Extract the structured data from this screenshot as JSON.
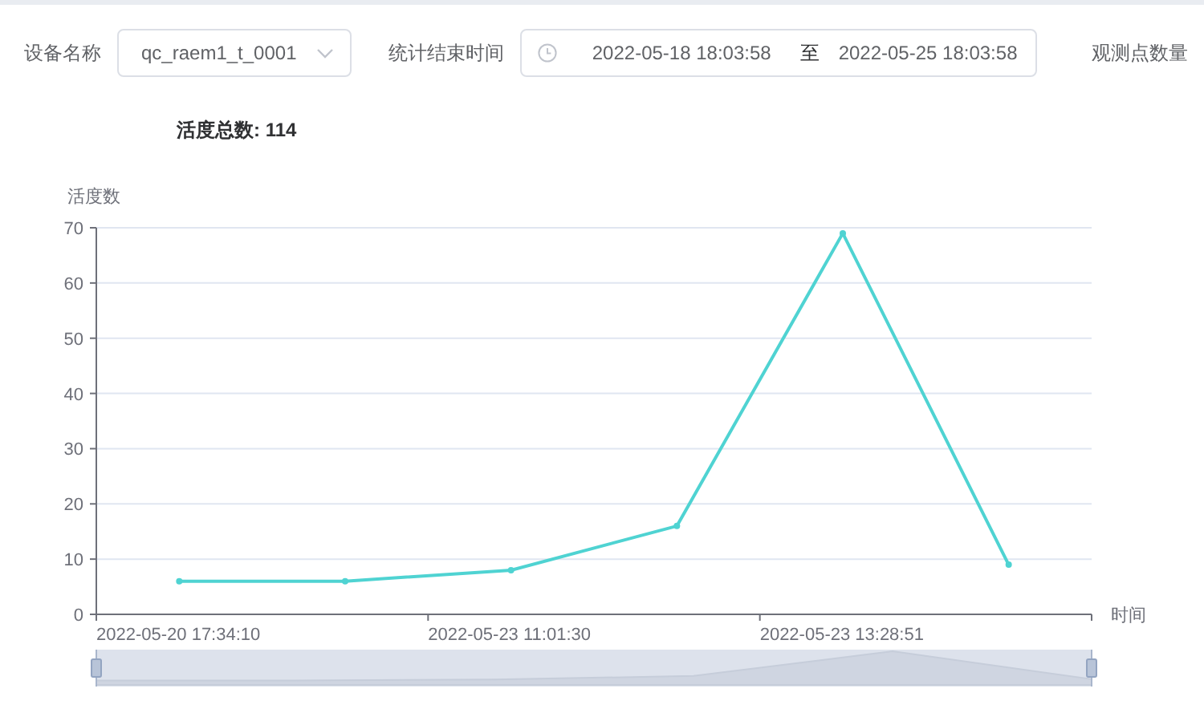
{
  "filters": [
    {
      "kind": "select",
      "label": "设备名称",
      "value": "qc_raem1_t_0001"
    },
    {
      "kind": "daterange",
      "label": "统计结束时间",
      "start": "2022-05-18 18:03:58",
      "separator": "至",
      "end": "2022-05-25 18:03:58"
    },
    {
      "kind": "label",
      "label": "观测点数量"
    }
  ],
  "summary": "活度总数: 114",
  "chart_data": {
    "type": "line",
    "ylabel": "活度数",
    "xlabel": "时间",
    "categories": [
      "2022-05-20 17:34:10",
      null,
      "2022-05-23 11:01:30",
      null,
      "2022-05-23 13:28:51",
      null
    ],
    "ylim": [
      0,
      70
    ],
    "grid": true,
    "yticks": [
      0,
      10,
      20,
      30,
      40,
      50,
      60,
      70
    ],
    "series": [
      {
        "color": "#4fd3d2",
        "marker": "circle",
        "values": [
          6,
          6,
          8,
          16,
          69,
          9
        ]
      }
    ]
  }
}
